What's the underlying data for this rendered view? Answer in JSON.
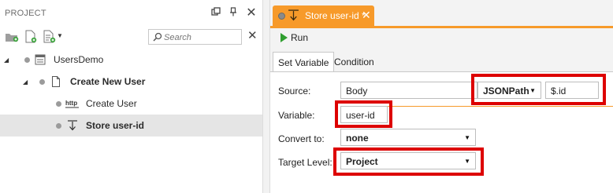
{
  "project_panel": {
    "title": "PROJECT",
    "search": {
      "placeholder": "Search",
      "value": ""
    }
  },
  "tree": [
    {
      "label": "UsersDemo",
      "icon": "project-icon"
    },
    {
      "label": "Create New User",
      "icon": "page-icon"
    },
    {
      "label": "Create User",
      "icon": "http-icon",
      "icon_text": "http"
    },
    {
      "label": "Store user-id",
      "icon": "store-arrow-icon",
      "selected": true
    }
  ],
  "editor": {
    "tab_title": "Store user-id *",
    "run_label": "Run",
    "subtabs": [
      "Set Variable",
      "Condition"
    ],
    "active_subtab": "Set Variable",
    "form": {
      "source_label": "Source:",
      "source_value": "Body",
      "path_type": "JSONPath",
      "path_value": "$.id",
      "variable_label": "Variable:",
      "variable_value": "user-id",
      "convert_label": "Convert to:",
      "convert_value": "none",
      "target_label": "Target Level:",
      "target_value": "Project"
    }
  },
  "colors": {
    "accent_orange": "#f79a2a",
    "highlight_red": "#dd0000",
    "run_green": "#2f9e2f",
    "selected_row": "#e5e5e5"
  }
}
